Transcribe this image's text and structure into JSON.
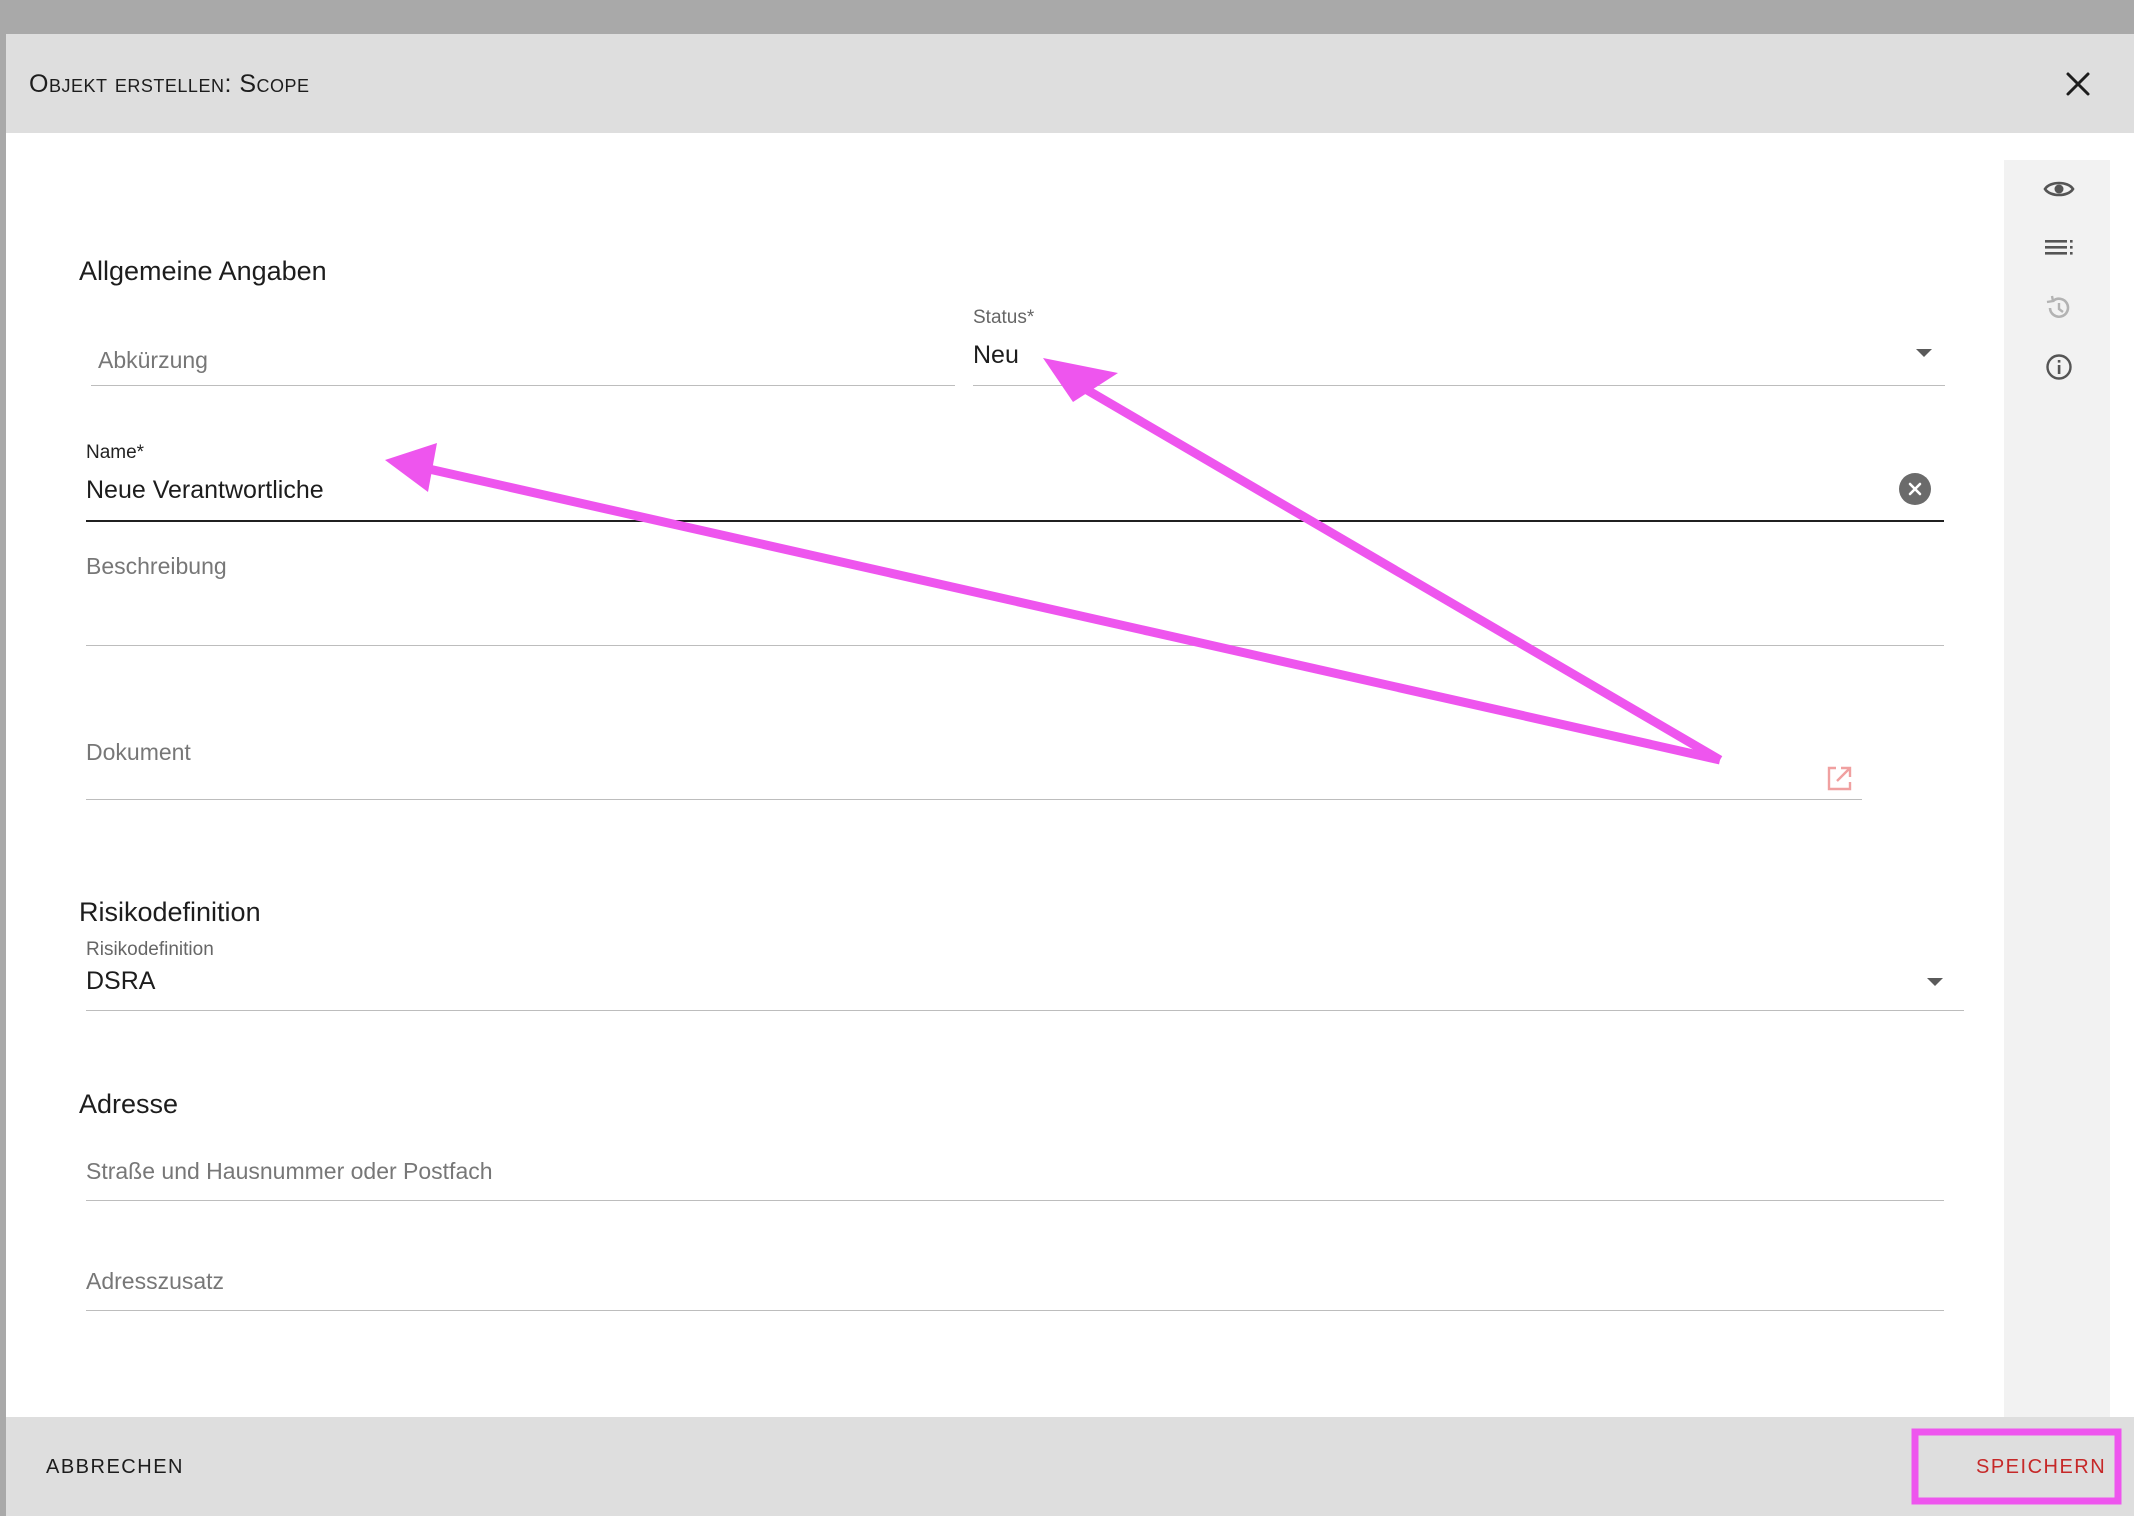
{
  "dialog": {
    "title": "Objekt erstellen: Scope"
  },
  "general": {
    "section_title": "Allgemeine Angaben",
    "abbreviation_placeholder": "Abkürzung",
    "status_label": "Status*",
    "status_value": "Neu",
    "name_label": "Name*",
    "name_value": "Neue Verantwortliche",
    "description_placeholder": "Beschreibung",
    "document_placeholder": "Dokument"
  },
  "risk": {
    "section_title": "Risikodefinition",
    "field_label": "Risikodefinition",
    "field_value": "DSRA"
  },
  "address": {
    "section_title": "Adresse",
    "street_placeholder": "Straße und Hausnummer oder Postfach",
    "addition_placeholder": "Adresszusatz"
  },
  "footer": {
    "cancel_label": "ABBRECHEN",
    "save_label": "SPEICHERN"
  },
  "sidebar": {
    "icons": [
      "eye-icon",
      "list-icon",
      "history-icon",
      "info-icon"
    ]
  },
  "colors": {
    "annotation": "#ee55ee",
    "save_text": "#c62828",
    "header_bg": "#dedede"
  }
}
